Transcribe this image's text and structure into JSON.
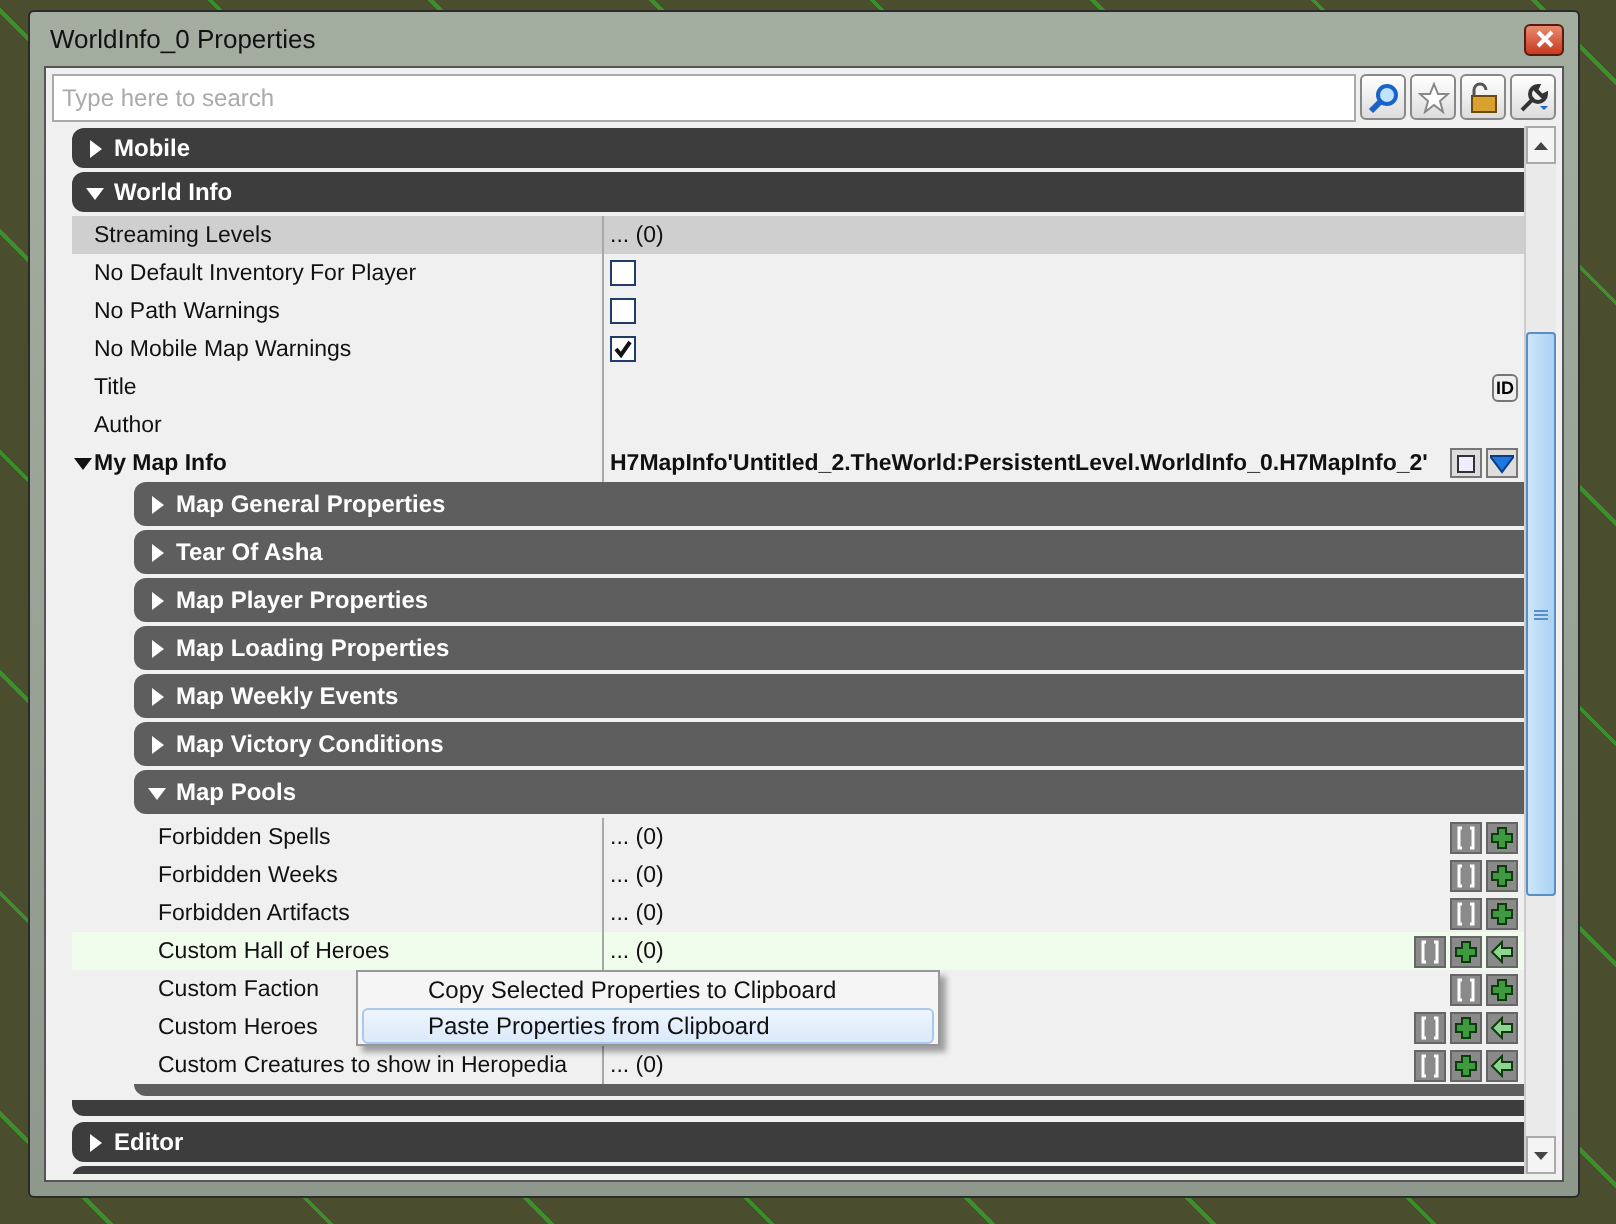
{
  "window": {
    "title": "WorldInfo_0 Properties"
  },
  "search": {
    "placeholder": "Type here to search"
  },
  "toolbar": [
    {
      "kind": "search"
    },
    {
      "kind": "star"
    },
    {
      "kind": "lock"
    },
    {
      "kind": "wrench"
    }
  ],
  "categories": [
    {
      "label": "Mobile",
      "expanded": false
    },
    {
      "label": "World Info",
      "expanded": true,
      "rows": [
        {
          "kind": "array",
          "name": "Streaming Levels",
          "value": "... (0)",
          "selected": true
        },
        {
          "kind": "checkbox",
          "name": "No Default Inventory For Player",
          "checked": false,
          "selected": false
        },
        {
          "kind": "checkbox",
          "name": "No Path Warnings",
          "checked": false,
          "selected": false
        },
        {
          "kind": "checkbox",
          "name": "No Mobile Map Warnings",
          "checked": true,
          "selected": false
        },
        {
          "kind": "text",
          "name": "Title",
          "id_button": "ID",
          "selected": false
        },
        {
          "kind": "text",
          "name": "Author",
          "selected": false
        },
        {
          "kind": "object",
          "name": "My Map Info",
          "value": "H7MapInfo'Untitled_2.TheWorld:PersistentLevel.WorldInfo_0.H7MapInfo_2'",
          "expanded": true,
          "selected": false,
          "actions": [
            {
              "kind": "square"
            },
            {
              "kind": "dropdown"
            }
          ],
          "groups": [
            {
              "label": "Map General Properties",
              "expanded": false
            },
            {
              "label": "Tear Of Asha",
              "expanded": false
            },
            {
              "label": "Map Player Properties",
              "expanded": false
            },
            {
              "label": "Map Loading Properties",
              "expanded": false
            },
            {
              "label": "Map Weekly Events",
              "expanded": false
            },
            {
              "label": "Map Victory Conditions",
              "expanded": false
            },
            {
              "label": "Map Pools",
              "expanded": true,
              "rows": [
                {
                  "name": "Forbidden Spells",
                  "value": "... (0)",
                  "highlighted": false,
                  "actions": [
                    {
                      "kind": "brackets"
                    },
                    {
                      "kind": "plus"
                    }
                  ]
                },
                {
                  "name": "Forbidden Weeks",
                  "value": "... (0)",
                  "highlighted": false,
                  "actions": [
                    {
                      "kind": "brackets"
                    },
                    {
                      "kind": "plus"
                    }
                  ]
                },
                {
                  "name": "Forbidden Artifacts",
                  "value": "... (0)",
                  "highlighted": false,
                  "actions": [
                    {
                      "kind": "brackets"
                    },
                    {
                      "kind": "plus"
                    }
                  ]
                },
                {
                  "name": "Custom Hall of Heroes",
                  "value": "... (0)",
                  "highlighted": true,
                  "actions": [
                    {
                      "kind": "brackets"
                    },
                    {
                      "kind": "plus"
                    },
                    {
                      "kind": "arrow"
                    }
                  ]
                },
                {
                  "name": "Custom Faction",
                  "highlighted": false,
                  "actions": [
                    {
                      "kind": "brackets"
                    },
                    {
                      "kind": "plus"
                    }
                  ]
                },
                {
                  "name": "Custom Heroes",
                  "highlighted": false,
                  "actions": [
                    {
                      "kind": "brackets"
                    },
                    {
                      "kind": "plus"
                    },
                    {
                      "kind": "arrow"
                    }
                  ]
                },
                {
                  "name": "Custom Creatures to show in Heropedia",
                  "value": "... (0)",
                  "highlighted": false,
                  "actions": [
                    {
                      "kind": "brackets"
                    },
                    {
                      "kind": "plus"
                    },
                    {
                      "kind": "arrow"
                    }
                  ]
                }
              ]
            }
          ]
        }
      ]
    },
    {
      "label": "Editor",
      "expanded": false
    },
    {
      "kind": "cut"
    }
  ],
  "context_menu": {
    "items": [
      {
        "label": "Copy Selected Properties to Clipboard",
        "selected": false
      },
      {
        "label": "Paste Properties from Clipboard",
        "selected": true
      }
    ]
  }
}
